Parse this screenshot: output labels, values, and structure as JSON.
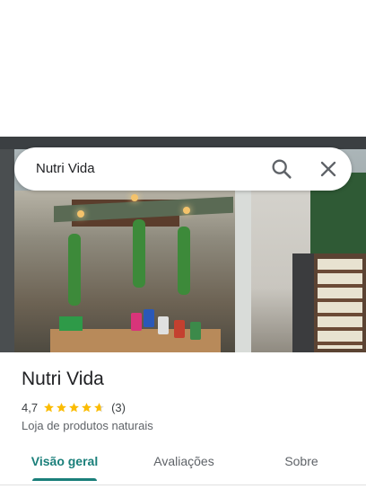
{
  "search": {
    "query": "Nutri Vida",
    "search_icon": "search-icon",
    "close_icon": "close-icon"
  },
  "place": {
    "name": "Nutri Vida",
    "rating": "4,7",
    "rating_value": 4.7,
    "stars_max": 5,
    "review_count": "(3)",
    "category": "Loja de produtos naturais",
    "photo": "storefront-photo"
  },
  "tabs": [
    {
      "label": "Visão geral",
      "active": true
    },
    {
      "label": "Avaliações",
      "active": false
    },
    {
      "label": "Sobre",
      "active": false
    }
  ],
  "colors": {
    "accent": "#1a7f7a",
    "star": "#fbbc04",
    "text_primary": "#202124",
    "text_secondary": "#5f6368"
  }
}
